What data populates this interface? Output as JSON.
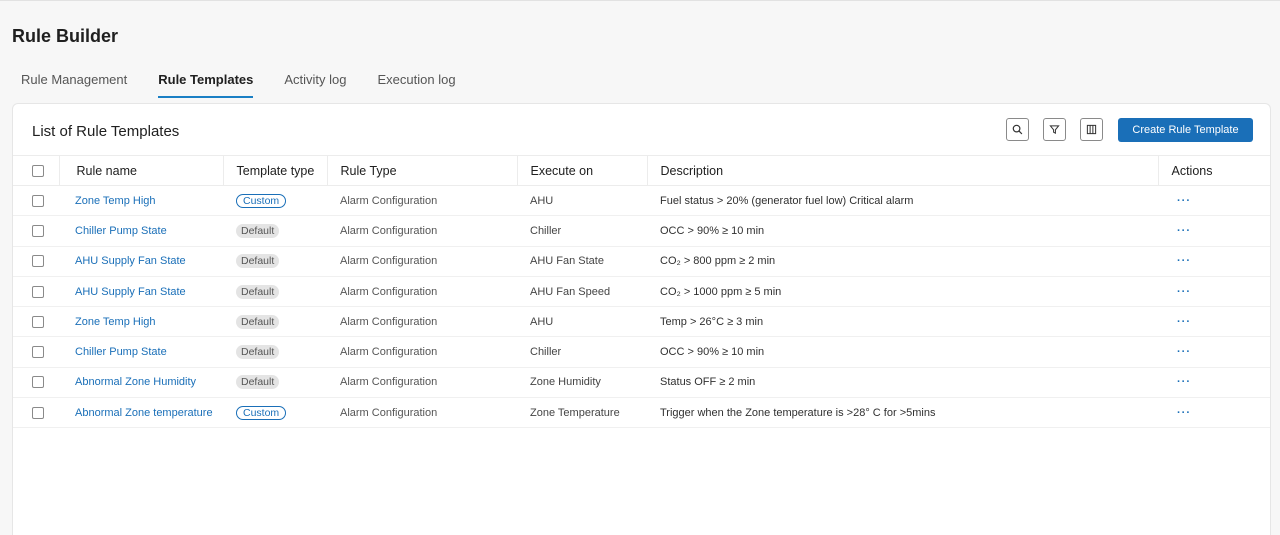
{
  "page": {
    "title": "Rule Builder"
  },
  "tabs": [
    {
      "label": "Rule Management"
    },
    {
      "label": "Rule Templates"
    },
    {
      "label": "Activity log"
    },
    {
      "label": "Execution log"
    }
  ],
  "active_tab": "Rule Templates",
  "card": {
    "title": "List of Rule Templates",
    "create_button_label": "Create Rule Template",
    "toolbar_icons": [
      "search-icon",
      "filter-icon",
      "columns-icon"
    ]
  },
  "colors": {
    "accent": "#1a6fb8",
    "tab_underline": "#1a7fc4",
    "badge_default_bg": "#e4e4e4"
  },
  "table": {
    "columns": [
      "Rule name",
      "Template type",
      "Rule Type",
      "Execute on",
      "Description",
      "Actions"
    ],
    "rows": [
      {
        "name": "Zone Temp High",
        "template_type": "Custom",
        "rule_type": "Alarm Configuration",
        "execute_on": "AHU",
        "description": "Fuel status > 20% (generator fuel low) Critical alarm",
        "action": "···"
      },
      {
        "name": "Chiller Pump State",
        "template_type": "Default",
        "rule_type": "Alarm Configuration",
        "execute_on": "Chiller",
        "description": "OCC > 90% ≥ 10 min",
        "action": "···"
      },
      {
        "name": "AHU Supply Fan State",
        "template_type": "Default",
        "rule_type": "Alarm Configuration",
        "execute_on": "AHU Fan State",
        "description": "CO₂ > 800 ppm ≥ 2 min",
        "action": "···"
      },
      {
        "name": "AHU Supply Fan State",
        "template_type": "Default",
        "rule_type": "Alarm Configuration",
        "execute_on": "AHU Fan Speed",
        "description": "CO₂ > 1000 ppm ≥ 5 min",
        "action": "···"
      },
      {
        "name": "Zone Temp High",
        "template_type": "Default",
        "rule_type": "Alarm Configuration",
        "execute_on": "AHU",
        "description": "Temp > 26°C ≥ 3 min",
        "action": "···"
      },
      {
        "name": "Chiller Pump State",
        "template_type": "Default",
        "rule_type": "Alarm Configuration",
        "execute_on": "Chiller",
        "description": "OCC > 90% ≥ 10 min",
        "action": "···"
      },
      {
        "name": "Abnormal Zone Humidity",
        "template_type": "Default",
        "rule_type": "Alarm Configuration",
        "execute_on": "Zone Humidity",
        "description": "Status OFF ≥ 2 min",
        "action": "···"
      },
      {
        "name": "Abnormal Zone temperature",
        "template_type": "Custom",
        "rule_type": "Alarm Configuration",
        "execute_on": "Zone Temperature",
        "description": "Trigger when the Zone temperature is >28° C for >5mins",
        "action": "···"
      }
    ]
  }
}
